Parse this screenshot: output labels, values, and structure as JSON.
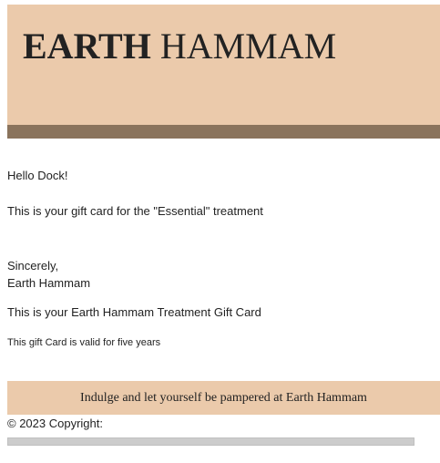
{
  "header": {
    "brand_strong": "EARTH",
    "brand_light": "HAMMAM",
    "background_color": "#ebcaab",
    "band_color": "#8a735c"
  },
  "message": {
    "greeting": "Hello Dock!",
    "body": "This is your gift card for the \"Essential\" treatment",
    "closing": "Sincerely,",
    "signature": "Earth Hammam",
    "card_title": "This is your Earth Hammam Treatment Gift Card",
    "validity": "This gift Card is valid for five years"
  },
  "promo": {
    "text": "Indulge and let yourself be pampered at Earth Hammam"
  },
  "footer": {
    "copyright": "© 2023 Copyright:"
  }
}
